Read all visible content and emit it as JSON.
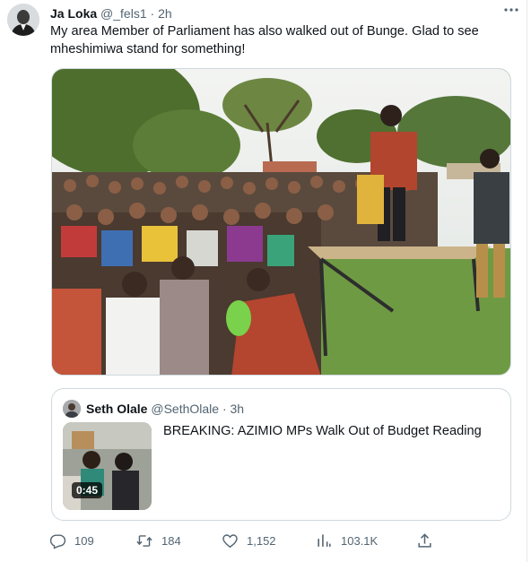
{
  "author": {
    "name": "Ja Loka",
    "handle": "@_fels1",
    "separator": "·",
    "time": "2h"
  },
  "tweet_text": "My area Member of Parliament has also walked out of Bunge. Glad to see mheshimiwa stand for something!",
  "quoted_tweet": {
    "name": "Seth Olale",
    "handle": "@SethOlale",
    "separator": "·",
    "time": "3h",
    "text": "BREAKING: AZIMIO MPs Walk Out of Budget Reading",
    "video_duration": "0:45"
  },
  "actions": {
    "replies": "109",
    "retweets": "184",
    "likes": "1,152",
    "views": "103.1K"
  },
  "icons": {
    "more": "more-icon",
    "reply": "reply-icon",
    "retweet": "retweet-icon",
    "like": "heart-icon",
    "views": "views-icon",
    "share": "share-icon"
  },
  "colors": {
    "text": "#0f1419",
    "secondary": "#536471",
    "border": "#cfd9de"
  }
}
